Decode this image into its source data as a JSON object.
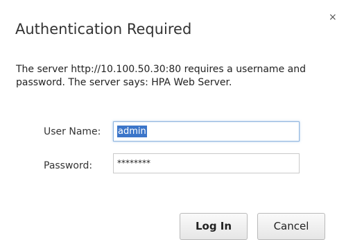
{
  "dialog": {
    "title": "Authentication Required",
    "close_icon": "close-icon",
    "close_glyph": "×",
    "message": "The server http://10.100.50.30:80 requires a username and password. The server says: HPA Web Server.",
    "username": {
      "label": "User Name:",
      "value": "admin",
      "selected": true
    },
    "password": {
      "label": "Password:",
      "masked_value": "********"
    },
    "buttons": {
      "login_label": "Log In",
      "cancel_label": "Cancel"
    }
  }
}
